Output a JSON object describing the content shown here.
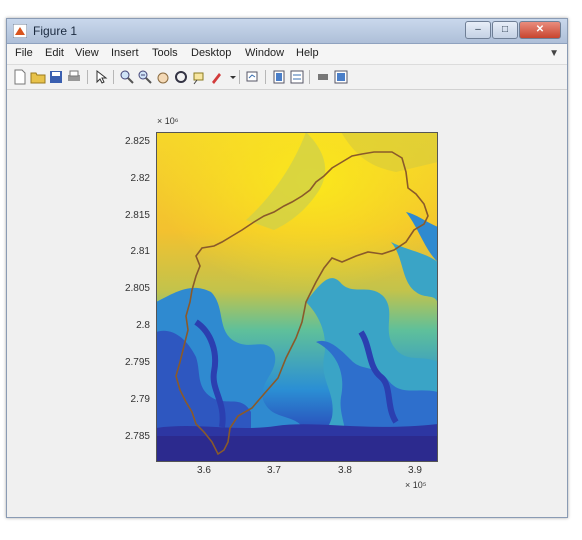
{
  "window": {
    "title": "Figure 1"
  },
  "menu": {
    "items": [
      "File",
      "Edit",
      "View",
      "Insert",
      "Tools",
      "Desktop",
      "Window",
      "Help"
    ]
  },
  "toolbar": {
    "icons": [
      "new-figure-icon",
      "open-file-icon",
      "save-icon",
      "print-icon",
      "pointer-icon",
      "zoom-in-icon",
      "zoom-out-icon",
      "pan-icon",
      "rotate-3d-icon",
      "data-cursor-icon",
      "brush-icon",
      "link-plot-icon",
      "colorbar-icon",
      "legend-icon",
      "hide-plot-tools-icon",
      "show-plot-tools-icon"
    ]
  },
  "axes": {
    "y_exponent": "× 10⁶",
    "x_exponent": "× 10⁵",
    "y_ticks": [
      "2.825",
      "2.82",
      "2.815",
      "2.81",
      "2.805",
      "2.8",
      "2.795",
      "2.79",
      "2.785"
    ],
    "x_ticks": [
      "3.6",
      "3.7",
      "3.8",
      "3.9"
    ]
  },
  "chart_data": {
    "type": "heatmap",
    "title": "",
    "xlabel": "",
    "ylabel": "",
    "x_ticks": [
      3.6,
      3.7,
      3.8,
      3.9
    ],
    "y_ticks": [
      2.825,
      2.82,
      2.815,
      2.81,
      2.805,
      2.8,
      2.795,
      2.79,
      2.785
    ],
    "x_multiplier": "1e5",
    "y_multiplier": "1e6",
    "xlim": [
      3.54,
      3.92
    ],
    "ylim": [
      2.7815,
      2.8285
    ],
    "colormap": "parula",
    "overlay": "catchment boundary outline",
    "colors": {
      "outline": "#8a5a2a",
      "high": "#f9e31f",
      "mid": "#3fb7a6",
      "low": "#2a2b8f"
    }
  }
}
